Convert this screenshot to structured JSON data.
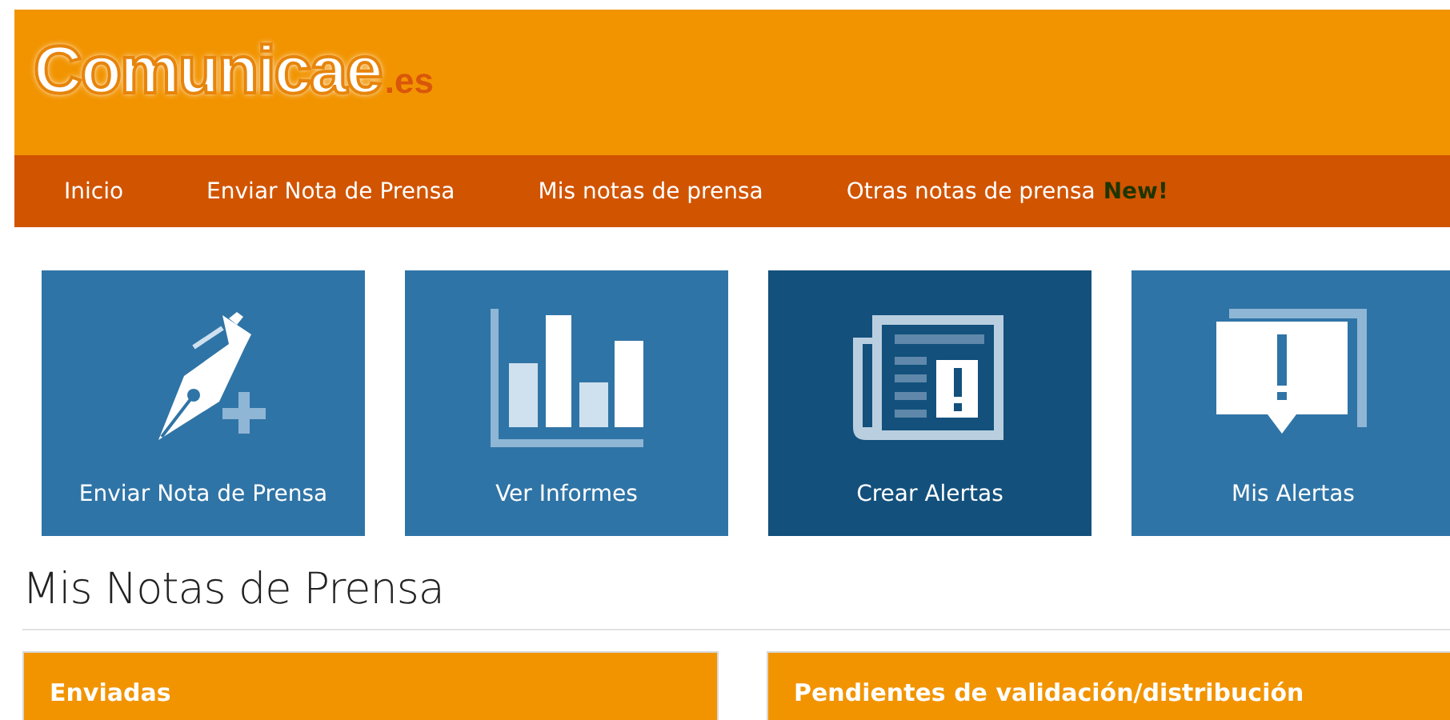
{
  "logo": {
    "name": "Comunicae",
    "suffix": ".es"
  },
  "nav": [
    {
      "label": "Inicio"
    },
    {
      "label": "Enviar Nota de Prensa"
    },
    {
      "label": "Mis notas de prensa"
    },
    {
      "label": "Otras notas de prensa",
      "badge": "New!"
    }
  ],
  "tiles": [
    {
      "label": "Enviar Nota de Prensa",
      "kind": "pen",
      "selected": false
    },
    {
      "label": "Ver Informes",
      "kind": "chart",
      "selected": false
    },
    {
      "label": "Crear Alertas",
      "kind": "newspaper",
      "selected": true
    },
    {
      "label": "Mis Alertas",
      "kind": "alert",
      "selected": false
    }
  ],
  "section_title": "Mis Notas de Prensa",
  "panels": [
    {
      "title": "Enviadas"
    },
    {
      "title": "Pendientes de validación/distribución"
    }
  ]
}
